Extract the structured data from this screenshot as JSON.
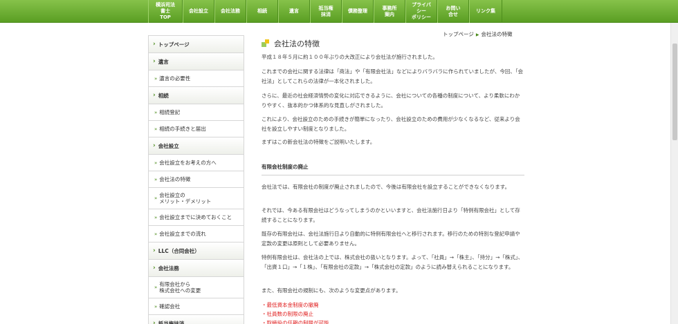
{
  "nav": {
    "items": [
      {
        "label": "横浜司法\n書士\nTOP",
        "w": 50
      },
      {
        "label": "会社設立",
        "w": 46
      },
      {
        "label": "会社法務",
        "w": 46
      },
      {
        "label": "相続",
        "w": 46
      },
      {
        "label": "遺言",
        "w": 46
      },
      {
        "label": "抵当権\n抹消",
        "w": 46
      },
      {
        "label": "債務整理",
        "w": 46
      },
      {
        "label": "事務所\n案内",
        "w": 46
      },
      {
        "label": "プライバ\nシー\nポリシー",
        "w": 46
      },
      {
        "label": "お問い\n合せ",
        "w": 46
      },
      {
        "label": "リンク集",
        "w": 48
      }
    ]
  },
  "breadcrumb": {
    "home": "トップページ",
    "current": "会社法の特徴"
  },
  "sidebar": {
    "items": [
      {
        "type": "cat",
        "label": "トップページ"
      },
      {
        "type": "cat",
        "label": "遺言"
      },
      {
        "type": "sub",
        "label": "遺言の必要性"
      },
      {
        "type": "cat",
        "label": "相続"
      },
      {
        "type": "sub",
        "label": "相続登記"
      },
      {
        "type": "sub",
        "label": "相続の手続きと届出"
      },
      {
        "type": "cat",
        "label": "会社設立"
      },
      {
        "type": "sub",
        "label": "会社設立をお考えの方へ"
      },
      {
        "type": "sub",
        "label": "会社法の特徴"
      },
      {
        "type": "sub2",
        "label": "会社設立の\nメリット・デメリット"
      },
      {
        "type": "sub",
        "label": "会社設立までに決めておくこと"
      },
      {
        "type": "sub",
        "label": "会社設立までの流れ"
      },
      {
        "type": "cat",
        "label": "LLC（合同会社）"
      },
      {
        "type": "cat",
        "label": "会社法務"
      },
      {
        "type": "sub2",
        "label": "有限会社から\n株式会社への変更"
      },
      {
        "type": "sub",
        "label": "確認会社"
      },
      {
        "type": "cat",
        "label": "抵当権抹消"
      }
    ]
  },
  "main": {
    "title": "会社法の特徴",
    "intro": [
      "平成１８年５月に約１００年ぶりの大改正により会社法が施行されました。",
      "これまでの会社に関する法律は「商法」や「有限会社法」などによりバラバラに作られていましたが、今回、「会社法」としてこれらの法律が一本化されました。",
      "さらに、最近の社会経済情勢の変化に対応できるように、会社についての各種の制度について、より柔軟にわかりやすく、抜本的かつ体系的な見直しがされました。",
      "これにより、会社設立のための手続きが簡単になったり、会社設立のための費用が少なくなるなど、従来より会社を設立しやすい制度となりました。",
      "まずはこの新会社法の特徴をご説明いたします。"
    ],
    "section_title": "有限会社制度の廃止",
    "section_paras": [
      "会社法では、有限会社の制度が廃止されましたので、今後は有限会社を設立することができなくなります。",
      "それでは、今ある有限会社はどうなってしまうのかといいますと、会社法施行日より「特例有限会社」として存続することになります。",
      "既存の有限会社は、会社法施行日より自動的に特例有限会社へと移行されます。移行のための特別な登記申請や定款の変更は原則として必要ありません。",
      "特例有限会社は、会社法の上では、株式会社の扱いとなります。よって、「社員」→「株主」、「持分」→「株式」、「出資１口」→「１株」、「有限会社の定款」→「株式会社の定款」のように読み替えられることになります。",
      "また、有限会社の規制にも、次のような変更点があります。"
    ],
    "changes": [
      "・最低資本金制度の撤廃",
      "・社員数の制限の廃止",
      "・取締役の任期の制限が可能"
    ]
  },
  "colors": {
    "nav_green": "#5a9e23",
    "accent_red": "#e02020",
    "title_green": "#9ccc5c",
    "title_yellow": "#f0c419"
  }
}
